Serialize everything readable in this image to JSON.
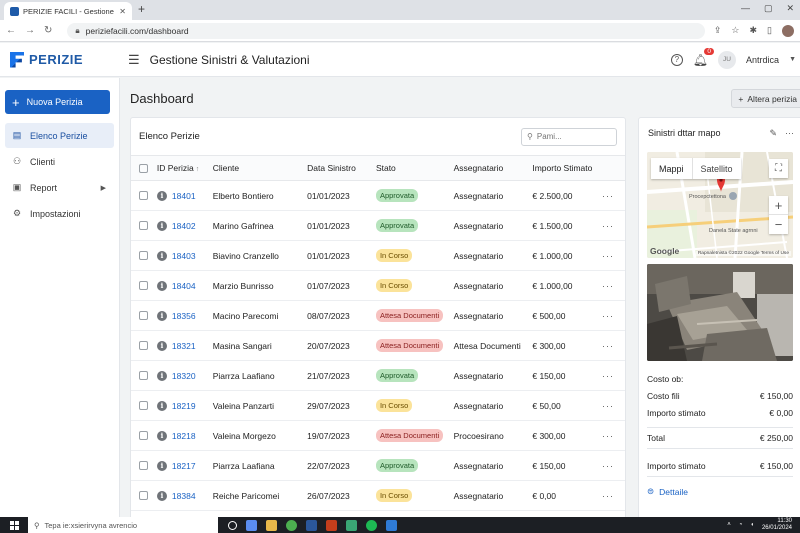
{
  "browser": {
    "tab_title": "PERIZIE FACILI - Gestione Sinistr",
    "url": "periziefacili.com/dashboard"
  },
  "app": {
    "brand": "PERIZIE",
    "title": "Gestione Sinistri & Valutazioni",
    "notifications": "0",
    "user_initials": "JU",
    "user_name": "Antrdica"
  },
  "sidebar": {
    "new_button": "Nuova Perizia",
    "items": [
      {
        "label": "Elenco Perizie",
        "icon": "document-icon",
        "active": true
      },
      {
        "label": "Clienti",
        "icon": "users-icon",
        "active": false
      },
      {
        "label": "Report",
        "icon": "report-icon",
        "active": false
      },
      {
        "label": "Impostazioni",
        "icon": "gear-icon",
        "active": false
      }
    ]
  },
  "main": {
    "page_title": "Dashboard",
    "top_button": "Altera perizia",
    "table": {
      "title": "Elenco Perizie",
      "search_placeholder": "Pami...",
      "columns": [
        "ID Perizia",
        "Cliente",
        "Data Sinistro",
        "Stato",
        "Assegnatario",
        "Importo Stimato"
      ],
      "rows": [
        {
          "id": "18401",
          "client": "Elberto Bontiero",
          "date": "01/01/2023",
          "status": "Approvata",
          "kind": "ok",
          "assignee": "Assegnatario",
          "amount": "€ 2.500,00"
        },
        {
          "id": "18402",
          "client": "Marino Gafrinea",
          "date": "01/01/2023",
          "status": "Approvata",
          "kind": "ok",
          "assignee": "Assegnatario",
          "amount": "€ 1.500,00"
        },
        {
          "id": "18403",
          "client": "Biavino Cranzello",
          "date": "01/01/2023",
          "status": "In Corso",
          "kind": "run",
          "assignee": "Assegnatario",
          "amount": "€ 1.000,00"
        },
        {
          "id": "18404",
          "client": "Marzio Bunrisso",
          "date": "01/07/2023",
          "status": "In Corso",
          "kind": "run",
          "assignee": "Assegnatario",
          "amount": "€ 1.000,00"
        },
        {
          "id": "18356",
          "client": "Macino Parecomi",
          "date": "08/07/2023",
          "status": "Attesa Documenti",
          "kind": "doc",
          "assignee": "Assegnatario",
          "amount": "€ 500,00"
        },
        {
          "id": "18321",
          "client": "Masina Sangari",
          "date": "20/07/2023",
          "status": "Attesa Documenti",
          "kind": "doc",
          "assignee": "Attesa Documenti",
          "amount": "€ 300,00"
        },
        {
          "id": "18320",
          "client": "Piarrza Laafiano",
          "date": "21/07/2023",
          "status": "Approvata",
          "kind": "ok",
          "assignee": "Assegnatario",
          "amount": "€ 150,00"
        },
        {
          "id": "18219",
          "client": "Valeina Panzarti",
          "date": "29/07/2023",
          "status": "In Corso",
          "kind": "run",
          "assignee": "Assegnatario",
          "amount": "€ 50,00"
        },
        {
          "id": "18218",
          "client": "Valeina Morgezo",
          "date": "19/07/2023",
          "status": "Attesa Documenti",
          "kind": "doc",
          "assignee": "Procoesirano",
          "amount": "€ 300,00"
        },
        {
          "id": "18217",
          "client": "Piarrza Laafiana",
          "date": "22/07/2023",
          "status": "Approvata",
          "kind": "ok",
          "assignee": "Assegnatario",
          "amount": "€ 150,00"
        },
        {
          "id": "18384",
          "client": "Reiche Paricomei",
          "date": "26/07/2023",
          "status": "In Corso",
          "kind": "run",
          "assignee": "Assegnatario",
          "amount": "€ 0,00"
        }
      ]
    }
  },
  "panel": {
    "title": "Sinistri dttar mapo",
    "map_tab_map": "Mappi",
    "map_tab_sat": "Satellito",
    "map_google": "Google",
    "map_attribution": "Rapnaletnista ©2022 Google   Terms of Use",
    "map_labels": [
      "Procepctettona",
      "Danela State agrnni"
    ],
    "costs_header": "Costo ob:",
    "cost_rows": [
      {
        "label": "Costo fili",
        "value": "€ 150,00"
      },
      {
        "label": "Importo stimato",
        "value": "€ 0,00"
      }
    ],
    "total_label": "Total",
    "total_value": "€ 250,00",
    "estimate_label": "Importo stimato",
    "estimate_value": "€ 150,00",
    "detail_link": "Dettaile"
  },
  "taskbar": {
    "search_placeholder": "Tepa ie:xsierirvyna avrencio",
    "time": "11:30",
    "date": "26/01/2024"
  },
  "colors": {
    "primary": "#1a62c4",
    "approved_bg": "#b7e4bd",
    "running_bg": "#fbe39a",
    "docs_bg": "#f7c2c0"
  }
}
